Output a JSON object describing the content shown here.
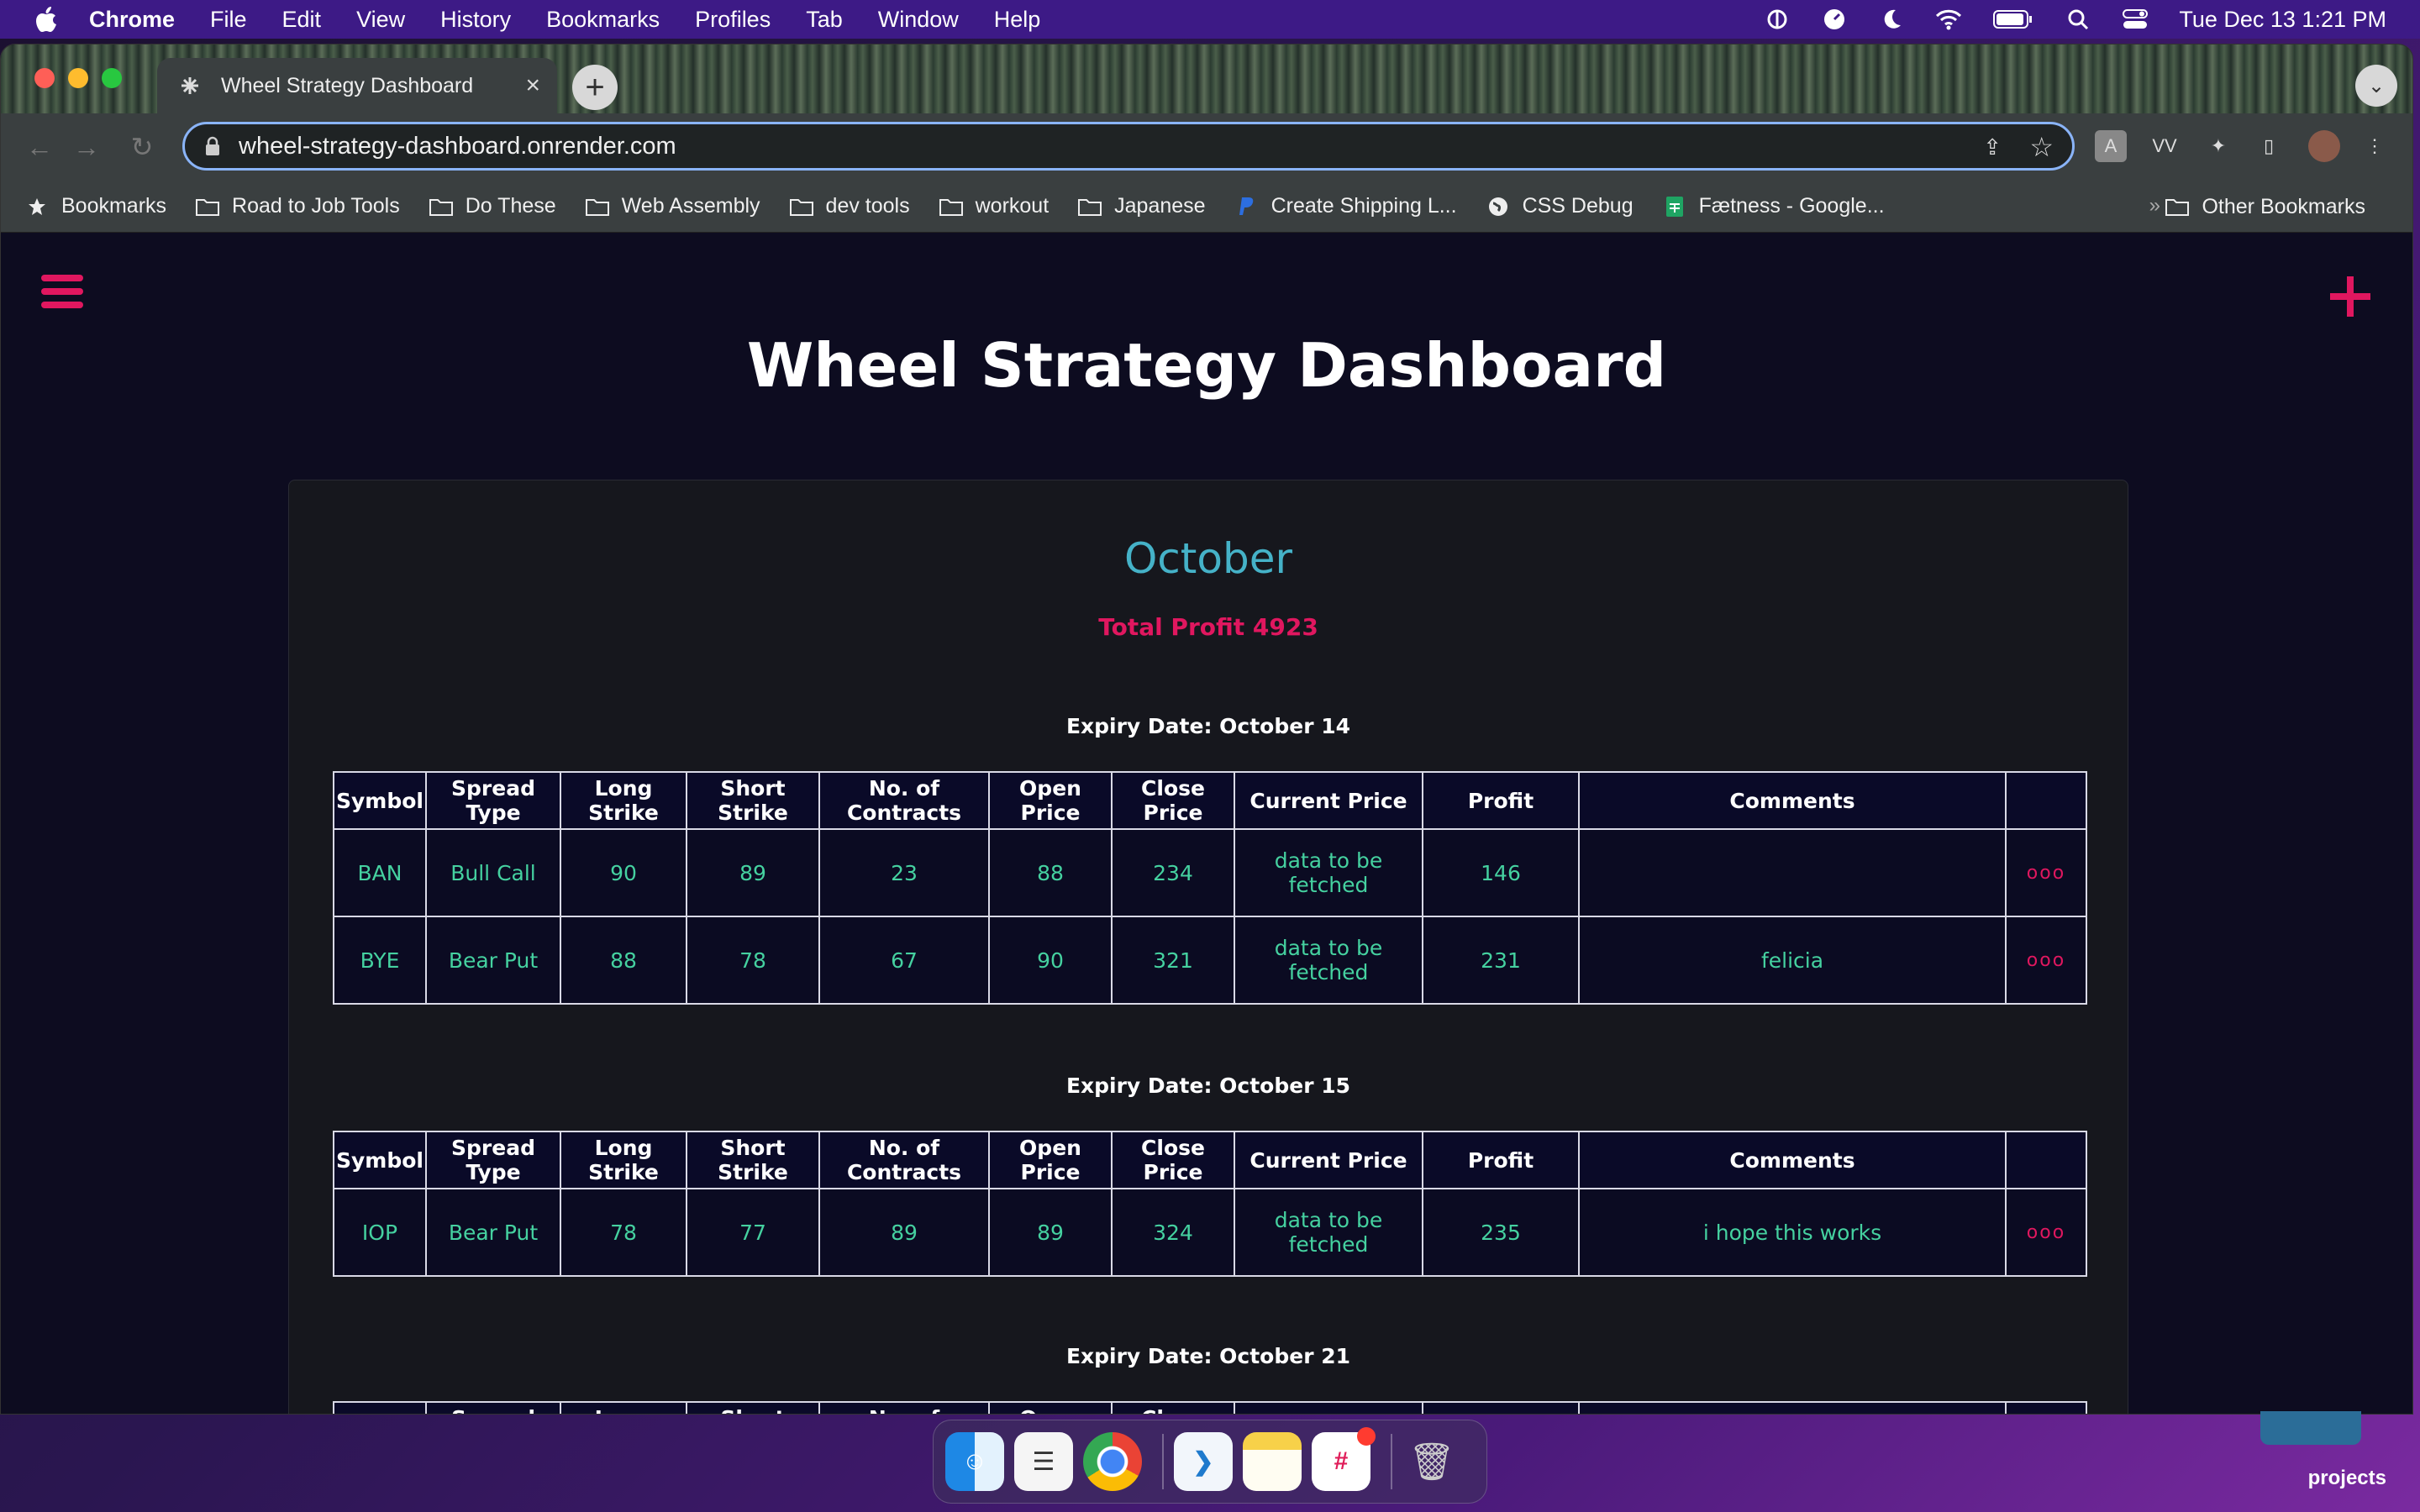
{
  "menubar": {
    "app_name": "Chrome",
    "items": [
      "File",
      "Edit",
      "View",
      "History",
      "Bookmarks",
      "Profiles",
      "Tab",
      "Window",
      "Help"
    ],
    "clock": "Tue Dec 13  1:21 PM"
  },
  "browser": {
    "tab_title": "Wheel Strategy Dashboard",
    "url": "wheel-strategy-dashboard.onrender.com",
    "bookmarks": [
      {
        "label": "Bookmarks",
        "icon": "star-icon"
      },
      {
        "label": "Road to Job Tools",
        "icon": "folder-icon"
      },
      {
        "label": "Do These",
        "icon": "folder-icon"
      },
      {
        "label": "Web Assembly",
        "icon": "folder-icon"
      },
      {
        "label": "dev tools",
        "icon": "folder-icon"
      },
      {
        "label": "workout",
        "icon": "folder-icon"
      },
      {
        "label": "Japanese",
        "icon": "folder-icon"
      },
      {
        "label": "Create Shipping L...",
        "icon": "paypal-icon"
      },
      {
        "label": "CSS Debug",
        "icon": "globe-icon"
      },
      {
        "label": "Fætness - Google...",
        "icon": "sheets-icon"
      }
    ],
    "other_bookmarks": "Other Bookmarks"
  },
  "page": {
    "title": "Wheel Strategy Dashboard",
    "month": "October",
    "total_profit": "Total Profit 4923",
    "columns": [
      "Symbol",
      "Spread Type",
      "Long Strike",
      "Short Strike",
      "No. of Contracts",
      "Open Price",
      "Close Price",
      "Current Price",
      "Profit",
      "Comments",
      ""
    ],
    "groups": [
      {
        "expiry": "Expiry Date: October 14",
        "rows": [
          {
            "symbol": "BAN",
            "spread": "Bull Call",
            "long": "90",
            "short": "89",
            "contracts": "23",
            "open": "88",
            "close": "234",
            "current": "data to be fetched",
            "profit": "146",
            "comments": "",
            "menu": "ooo"
          },
          {
            "symbol": "BYE",
            "spread": "Bear Put",
            "long": "88",
            "short": "78",
            "contracts": "67",
            "open": "90",
            "close": "321",
            "current": "data to be fetched",
            "profit": "231",
            "comments": "felicia",
            "menu": "ooo"
          }
        ]
      },
      {
        "expiry": "Expiry Date: October 15",
        "rows": [
          {
            "symbol": "IOP",
            "spread": "Bear Put",
            "long": "78",
            "short": "77",
            "contracts": "89",
            "open": "89",
            "close": "324",
            "current": "data to be fetched",
            "profit": "235",
            "comments": "i hope this works",
            "menu": "ooo"
          }
        ]
      },
      {
        "expiry": "Expiry Date: October 21",
        "rows": []
      }
    ]
  },
  "desktop": {
    "folder_label": "projects"
  },
  "colors": {
    "accent": "#e0175f",
    "month": "#45b2c8",
    "cell_text": "#45d1a0",
    "page_bg": "#0d0c20"
  }
}
